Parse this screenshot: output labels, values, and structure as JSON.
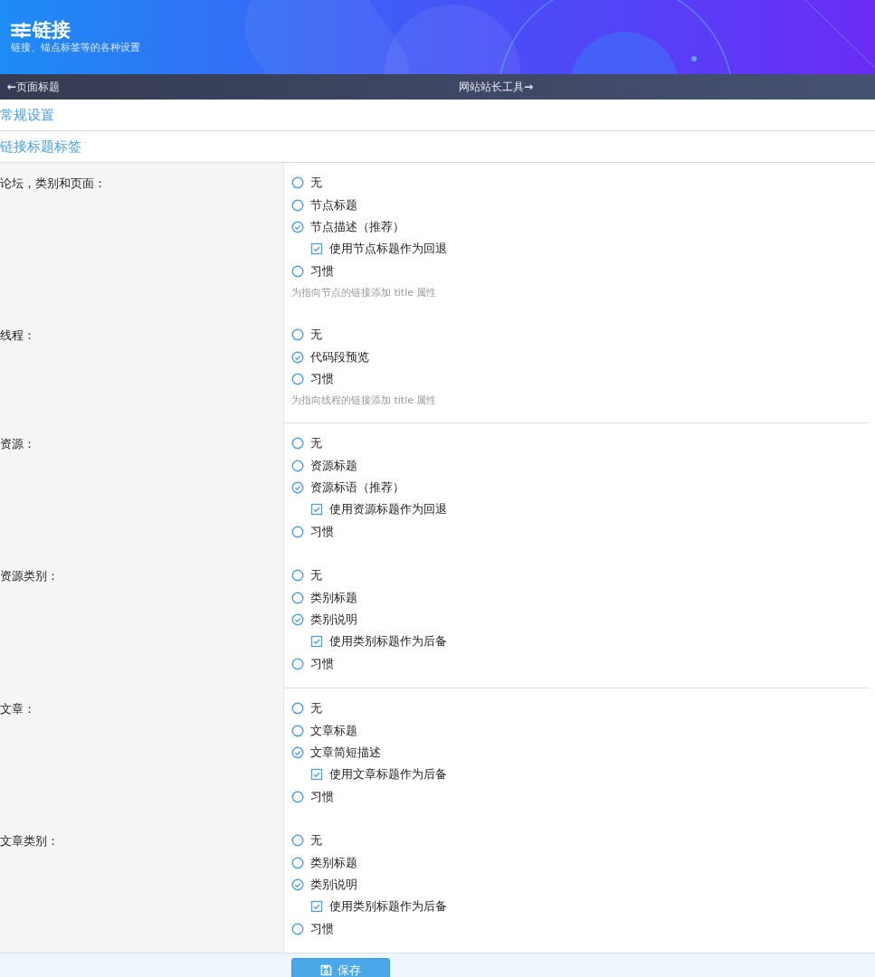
{
  "header": {
    "title": "链接",
    "subtitle": "链接、锚点标签等的各种设置"
  },
  "nav": {
    "prev_arrow": "←",
    "prev": "页面标题",
    "next": "网站站长工具",
    "next_arrow": "→"
  },
  "sections": [
    "常规设置",
    "链接标题标签"
  ],
  "rows": [
    {
      "label": "论坛，类别和页面：",
      "divider_below": false,
      "hint": "为指向节点的链接添加 title 属性",
      "options": [
        {
          "kind": "radio",
          "label": "无",
          "selected": false
        },
        {
          "kind": "radio",
          "label": "节点标题",
          "selected": false
        },
        {
          "kind": "radio",
          "label": "节点描述（推荐）",
          "selected": true
        },
        {
          "kind": "checkbox",
          "label": "使用节点标题作为回退",
          "checked": true
        },
        {
          "kind": "radio",
          "label": "习惯",
          "selected": false
        }
      ]
    },
    {
      "label": "线程：",
      "divider_below": true,
      "hint": "为指向线程的链接添加 title 属性",
      "options": [
        {
          "kind": "radio",
          "label": "无",
          "selected": false
        },
        {
          "kind": "radio",
          "label": "代码段预览",
          "selected": true
        },
        {
          "kind": "radio",
          "label": "习惯",
          "selected": false
        }
      ]
    },
    {
      "label": "资源：",
      "divider_below": false,
      "options": [
        {
          "kind": "radio",
          "label": "无",
          "selected": false
        },
        {
          "kind": "radio",
          "label": "资源标题",
          "selected": false
        },
        {
          "kind": "radio",
          "label": "资源标语（推荐）",
          "selected": true
        },
        {
          "kind": "checkbox",
          "label": "使用资源标题作为回退",
          "checked": true
        },
        {
          "kind": "radio",
          "label": "习惯",
          "selected": false
        }
      ]
    },
    {
      "label": "资源类别：",
      "divider_below": true,
      "options": [
        {
          "kind": "radio",
          "label": "无",
          "selected": false
        },
        {
          "kind": "radio",
          "label": "类别标题",
          "selected": false
        },
        {
          "kind": "radio",
          "label": "类别说明",
          "selected": true
        },
        {
          "kind": "checkbox",
          "label": "使用类别标题作为后备",
          "checked": true
        },
        {
          "kind": "radio",
          "label": "习惯",
          "selected": false
        }
      ]
    },
    {
      "label": "文章：",
      "divider_below": false,
      "options": [
        {
          "kind": "radio",
          "label": "无",
          "selected": false
        },
        {
          "kind": "radio",
          "label": "文章标题",
          "selected": false
        },
        {
          "kind": "radio",
          "label": "文章简短描述",
          "selected": true
        },
        {
          "kind": "checkbox",
          "label": "使用文章标题作为后备",
          "checked": true
        },
        {
          "kind": "radio",
          "label": "习惯",
          "selected": false
        }
      ]
    },
    {
      "label": "文章类别：",
      "divider_below": false,
      "options": [
        {
          "kind": "radio",
          "label": "无",
          "selected": false
        },
        {
          "kind": "radio",
          "label": "类别标题",
          "selected": false
        },
        {
          "kind": "radio",
          "label": "类别说明",
          "selected": true
        },
        {
          "kind": "checkbox",
          "label": "使用类别标题作为后备",
          "checked": true
        },
        {
          "kind": "radio",
          "label": "习惯",
          "selected": false
        }
      ]
    }
  ],
  "save_button": "保存"
}
